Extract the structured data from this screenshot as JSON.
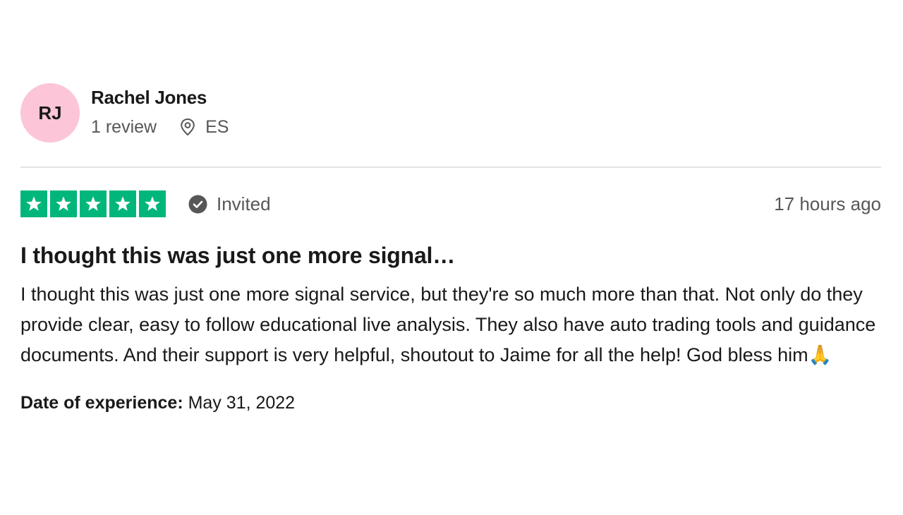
{
  "reviewer": {
    "initials": "RJ",
    "name": "Rachel Jones",
    "review_count": "1 review",
    "location": "ES",
    "avatar_color": "#fcc5d8"
  },
  "rating": {
    "stars": 5,
    "max_stars": 5,
    "star_color": "#00b67a",
    "status": "Invited",
    "status_icon": "check-circle-icon",
    "time_ago": "17 hours ago"
  },
  "review": {
    "title": "I thought this was just one more signal…",
    "body": "I thought this was just one more signal service, but they're so much more than that. Not only do they provide clear, easy to follow educational live analysis. They also have auto trading tools and guidance documents. And their support is very helpful, shoutout to Jaime for all the help! God bless him🙏"
  },
  "experience": {
    "label": "Date of experience:",
    "date": "May 31, 2022"
  }
}
